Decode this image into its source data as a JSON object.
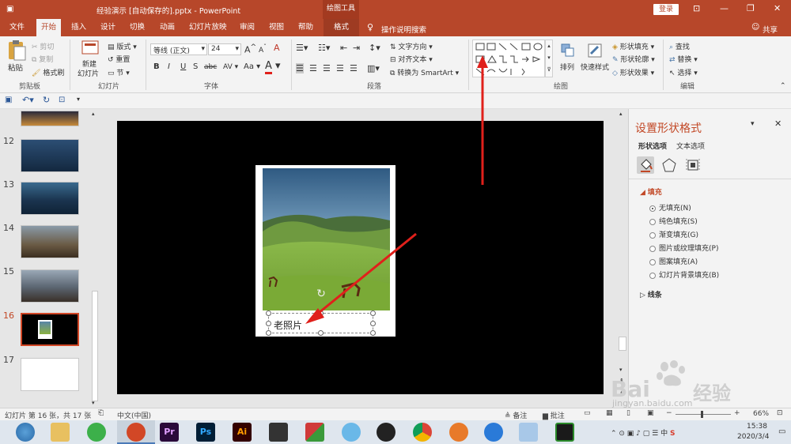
{
  "title_bar": {
    "doc_title": "经验演示 [自动保存的].pptx  -  PowerPoint",
    "context_tool": "绘图工具",
    "login": "登录"
  },
  "tabs": [
    "文件",
    "开始",
    "插入",
    "设计",
    "切换",
    "动画",
    "幻灯片放映",
    "审阅",
    "视图",
    "帮助",
    "格式"
  ],
  "tell_me": "操作说明搜索",
  "share": "共享",
  "ribbon": {
    "clipboard": {
      "paste": "粘贴",
      "cut": "剪切",
      "copy": "复制",
      "format_painter": "格式刷",
      "label": "剪贴板"
    },
    "slides": {
      "new_slide_1": "新建",
      "new_slide_2": "幻灯片",
      "layout": "版式",
      "reset": "重置",
      "section": "节",
      "label": "幻灯片"
    },
    "font": {
      "name": "等线 (正文)",
      "size": "24",
      "label": "字体",
      "bold": "B",
      "italic": "I",
      "underline": "U",
      "strike": "S",
      "shadow": "abc",
      "spacing": "AV",
      "case": "Aa",
      "grow": "A",
      "shrink": "A",
      "clear": "A"
    },
    "paragraph": {
      "text_direction": "文字方向",
      "align_text": "对齐文本",
      "smartart": "转换为 SmartArt",
      "label": "段落"
    },
    "drawing": {
      "arrange": "排列",
      "quick_styles": "快速样式",
      "shape_fill": "形状填充",
      "shape_outline": "形状轮廓",
      "shape_effects": "形状效果",
      "label": "绘图"
    },
    "editing": {
      "find": "查找",
      "replace": "替换",
      "select": "选择",
      "label": "编辑"
    }
  },
  "thumbnails": [
    {
      "num": "12",
      "bg": "#1a3450"
    },
    {
      "num": "13",
      "bg": "#1d3b57"
    },
    {
      "num": "14",
      "bg": "#6a5a44"
    },
    {
      "num": "15",
      "bg": "#5a6470"
    },
    {
      "num": "16",
      "bg": "#000000"
    },
    {
      "num": "17",
      "bg": "#ffffff"
    }
  ],
  "slide": {
    "caption": "老照片"
  },
  "format_pane": {
    "title": "设置形状格式",
    "tab_shape": "形状选项",
    "tab_text": "文本选项",
    "fill_header": "填充",
    "fill_options": [
      "无填充(N)",
      "纯色填充(S)",
      "渐变填充(G)",
      "图片或纹理填充(P)",
      "图案填充(A)",
      "幻灯片背景填充(B)"
    ],
    "selected_fill": "无填充(N)",
    "line_header": "线条"
  },
  "status": {
    "slide_info": "幻灯片 第 16 张，共 17 张",
    "language": "中文(中国)",
    "notes": "备注",
    "comments": "批注",
    "zoom": "66%"
  },
  "taskbar": {
    "time": "15:38",
    "date": "2020/3/4",
    "adobe_pr": "Pr",
    "adobe_ps": "Ps",
    "adobe_ai": "Ai"
  },
  "watermark": {
    "brand": "Bai",
    "brand2": "经验",
    "url": "jingyan.baidu.com"
  },
  "colors": {
    "accent": "#b7472a",
    "arrow": "#e0201b"
  }
}
